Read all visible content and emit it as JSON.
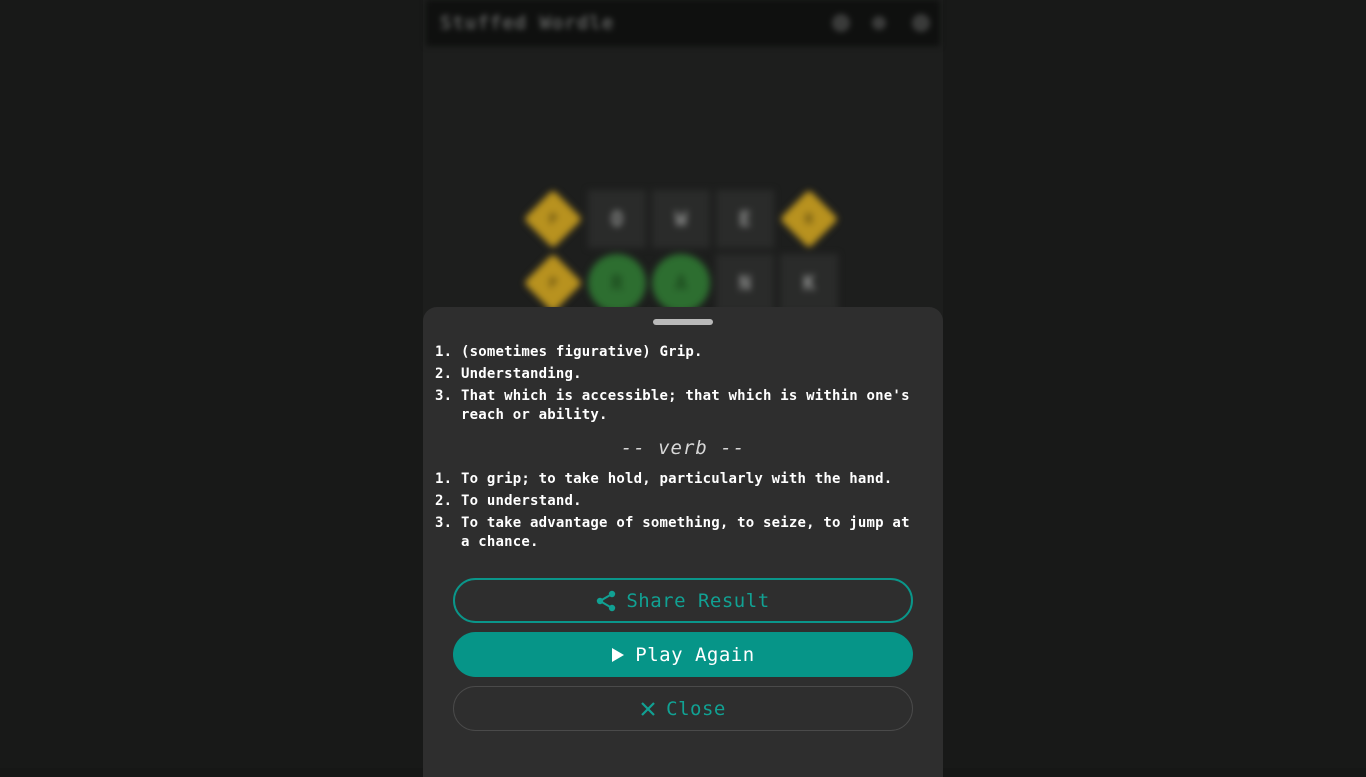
{
  "app": {
    "title": "Stuffed Wordle"
  },
  "board": {
    "rows": [
      [
        {
          "letter": "P",
          "state": "present"
        },
        {
          "letter": "O",
          "state": "empty"
        },
        {
          "letter": "W",
          "state": "empty"
        },
        {
          "letter": "E",
          "state": "empty"
        },
        {
          "letter": "R",
          "state": "present"
        }
      ],
      [
        {
          "letter": "P",
          "state": "present"
        },
        {
          "letter": "R",
          "state": "correct"
        },
        {
          "letter": "A",
          "state": "correct"
        },
        {
          "letter": "N",
          "state": "empty"
        },
        {
          "letter": "K",
          "state": "empty"
        }
      ]
    ]
  },
  "sheet": {
    "noun_definitions": [
      {
        "num": "1.",
        "text": "(sometimes figurative) Grip."
      },
      {
        "num": "2.",
        "text": "Understanding."
      },
      {
        "num": "3.",
        "text": "That which is accessible; that which is within one's reach or ability."
      }
    ],
    "verb_heading": "-- verb --",
    "verb_definitions": [
      {
        "num": "1.",
        "text": "To grip; to take hold, particularly with the hand."
      },
      {
        "num": "2.",
        "text": "To understand."
      },
      {
        "num": "3.",
        "text": "To take advantage of something, to seize, to jump at a chance."
      }
    ],
    "buttons": {
      "share_label": "Share Result",
      "play_label": "Play Again",
      "close_label": "Close"
    }
  },
  "colors": {
    "accent": "#069588",
    "present": "#b8921f",
    "correct": "#2d6e30",
    "sheet_bg": "#2e2e2e"
  },
  "icons": {
    "share": "share-icon",
    "play": "play-icon",
    "close": "close-icon"
  }
}
